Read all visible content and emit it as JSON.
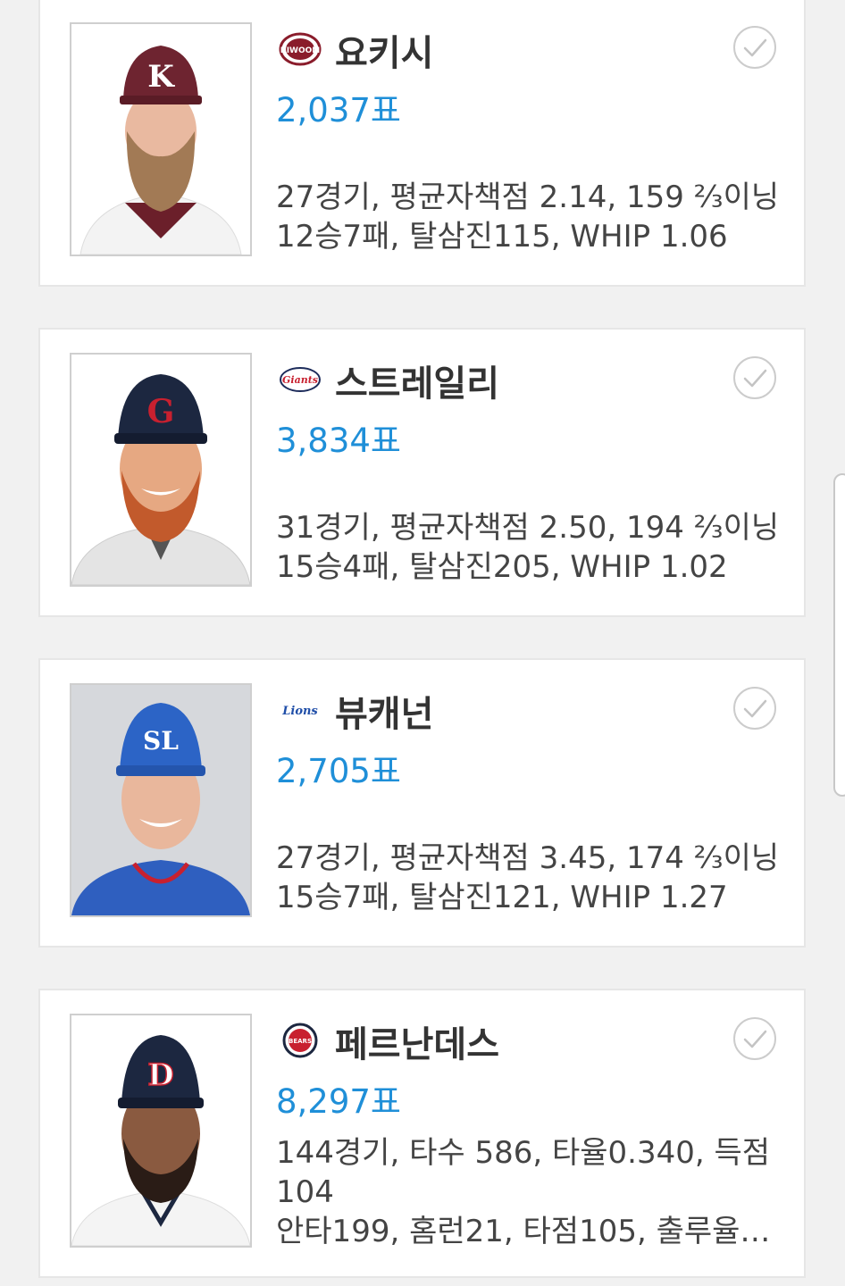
{
  "colors": {
    "vote_blue": "#1f8fd8",
    "text": "#444444",
    "name": "#333333",
    "background": "#f1f1f1"
  },
  "players": [
    {
      "team_logo": "kiwoom-heroes-logo",
      "team_logo_text": "KIWOOM",
      "name": "요키시",
      "votes": "2,037표",
      "stats_line1": "27경기, 평균자책점 2.14, 159 ⅔이닝",
      "stats_line2": "12승7패, 탈삼진115, WHIP 1.06"
    },
    {
      "team_logo": "lotte-giants-logo",
      "team_logo_text": "Giants",
      "name": "스트레일리",
      "votes": "3,834표",
      "stats_line1": "31경기, 평균자책점 2.50, 194 ⅔이닝",
      "stats_line2": "15승4패, 탈삼진205, WHIP 1.02"
    },
    {
      "team_logo": "samsung-lions-logo",
      "team_logo_text": "Lions",
      "name": "뷰캐넌",
      "votes": "2,705표",
      "stats_line1": "27경기, 평균자책점 3.45, 174 ⅔이닝",
      "stats_line2": "15승7패, 탈삼진121, WHIP 1.27"
    },
    {
      "team_logo": "doosan-bears-logo",
      "team_logo_text": "BEARS",
      "name": "페르난데스",
      "votes": "8,297표",
      "stats_line1": "144경기, 타수 586, 타율0.340, 득점 104",
      "stats_line2": "안타199, 홈런21, 타점105, 출루율 0...."
    }
  ]
}
